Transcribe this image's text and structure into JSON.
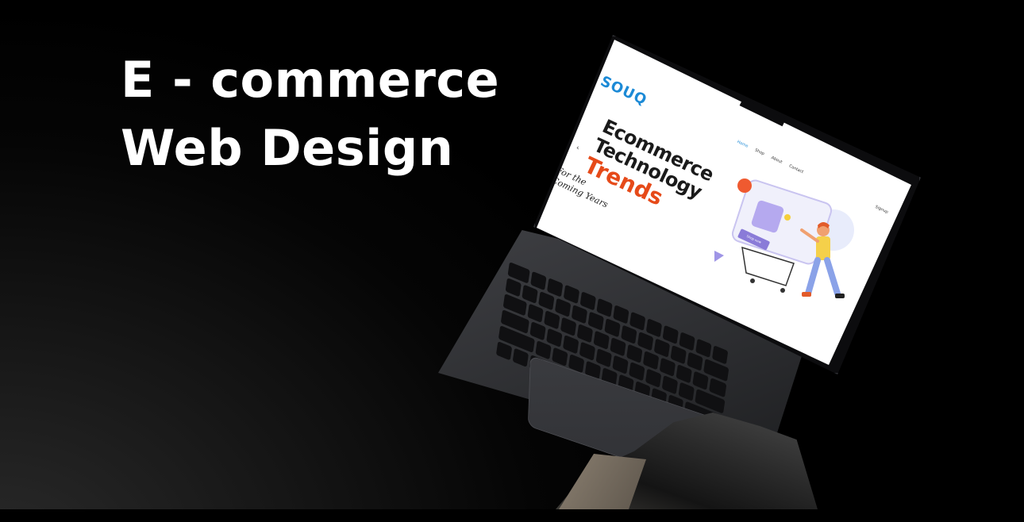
{
  "headline": {
    "line1": "E - commerce",
    "line2": "Web Design"
  },
  "site": {
    "logo": "SOUQ",
    "nav": [
      "Home",
      "Shop",
      "About",
      "Contact"
    ],
    "signup": "Signup",
    "hero": {
      "line1": "Ecommerce",
      "line2": "Technology",
      "line3": "Trends",
      "script1": "For the",
      "script2": "Coming Years"
    },
    "shop_button": "Shop now"
  },
  "colors": {
    "brand_blue": "#1c8ad6",
    "accent_orange": "#e64a19",
    "button_purple": "#8a7bd8",
    "background": "#000000",
    "headline": "#ffffff"
  }
}
